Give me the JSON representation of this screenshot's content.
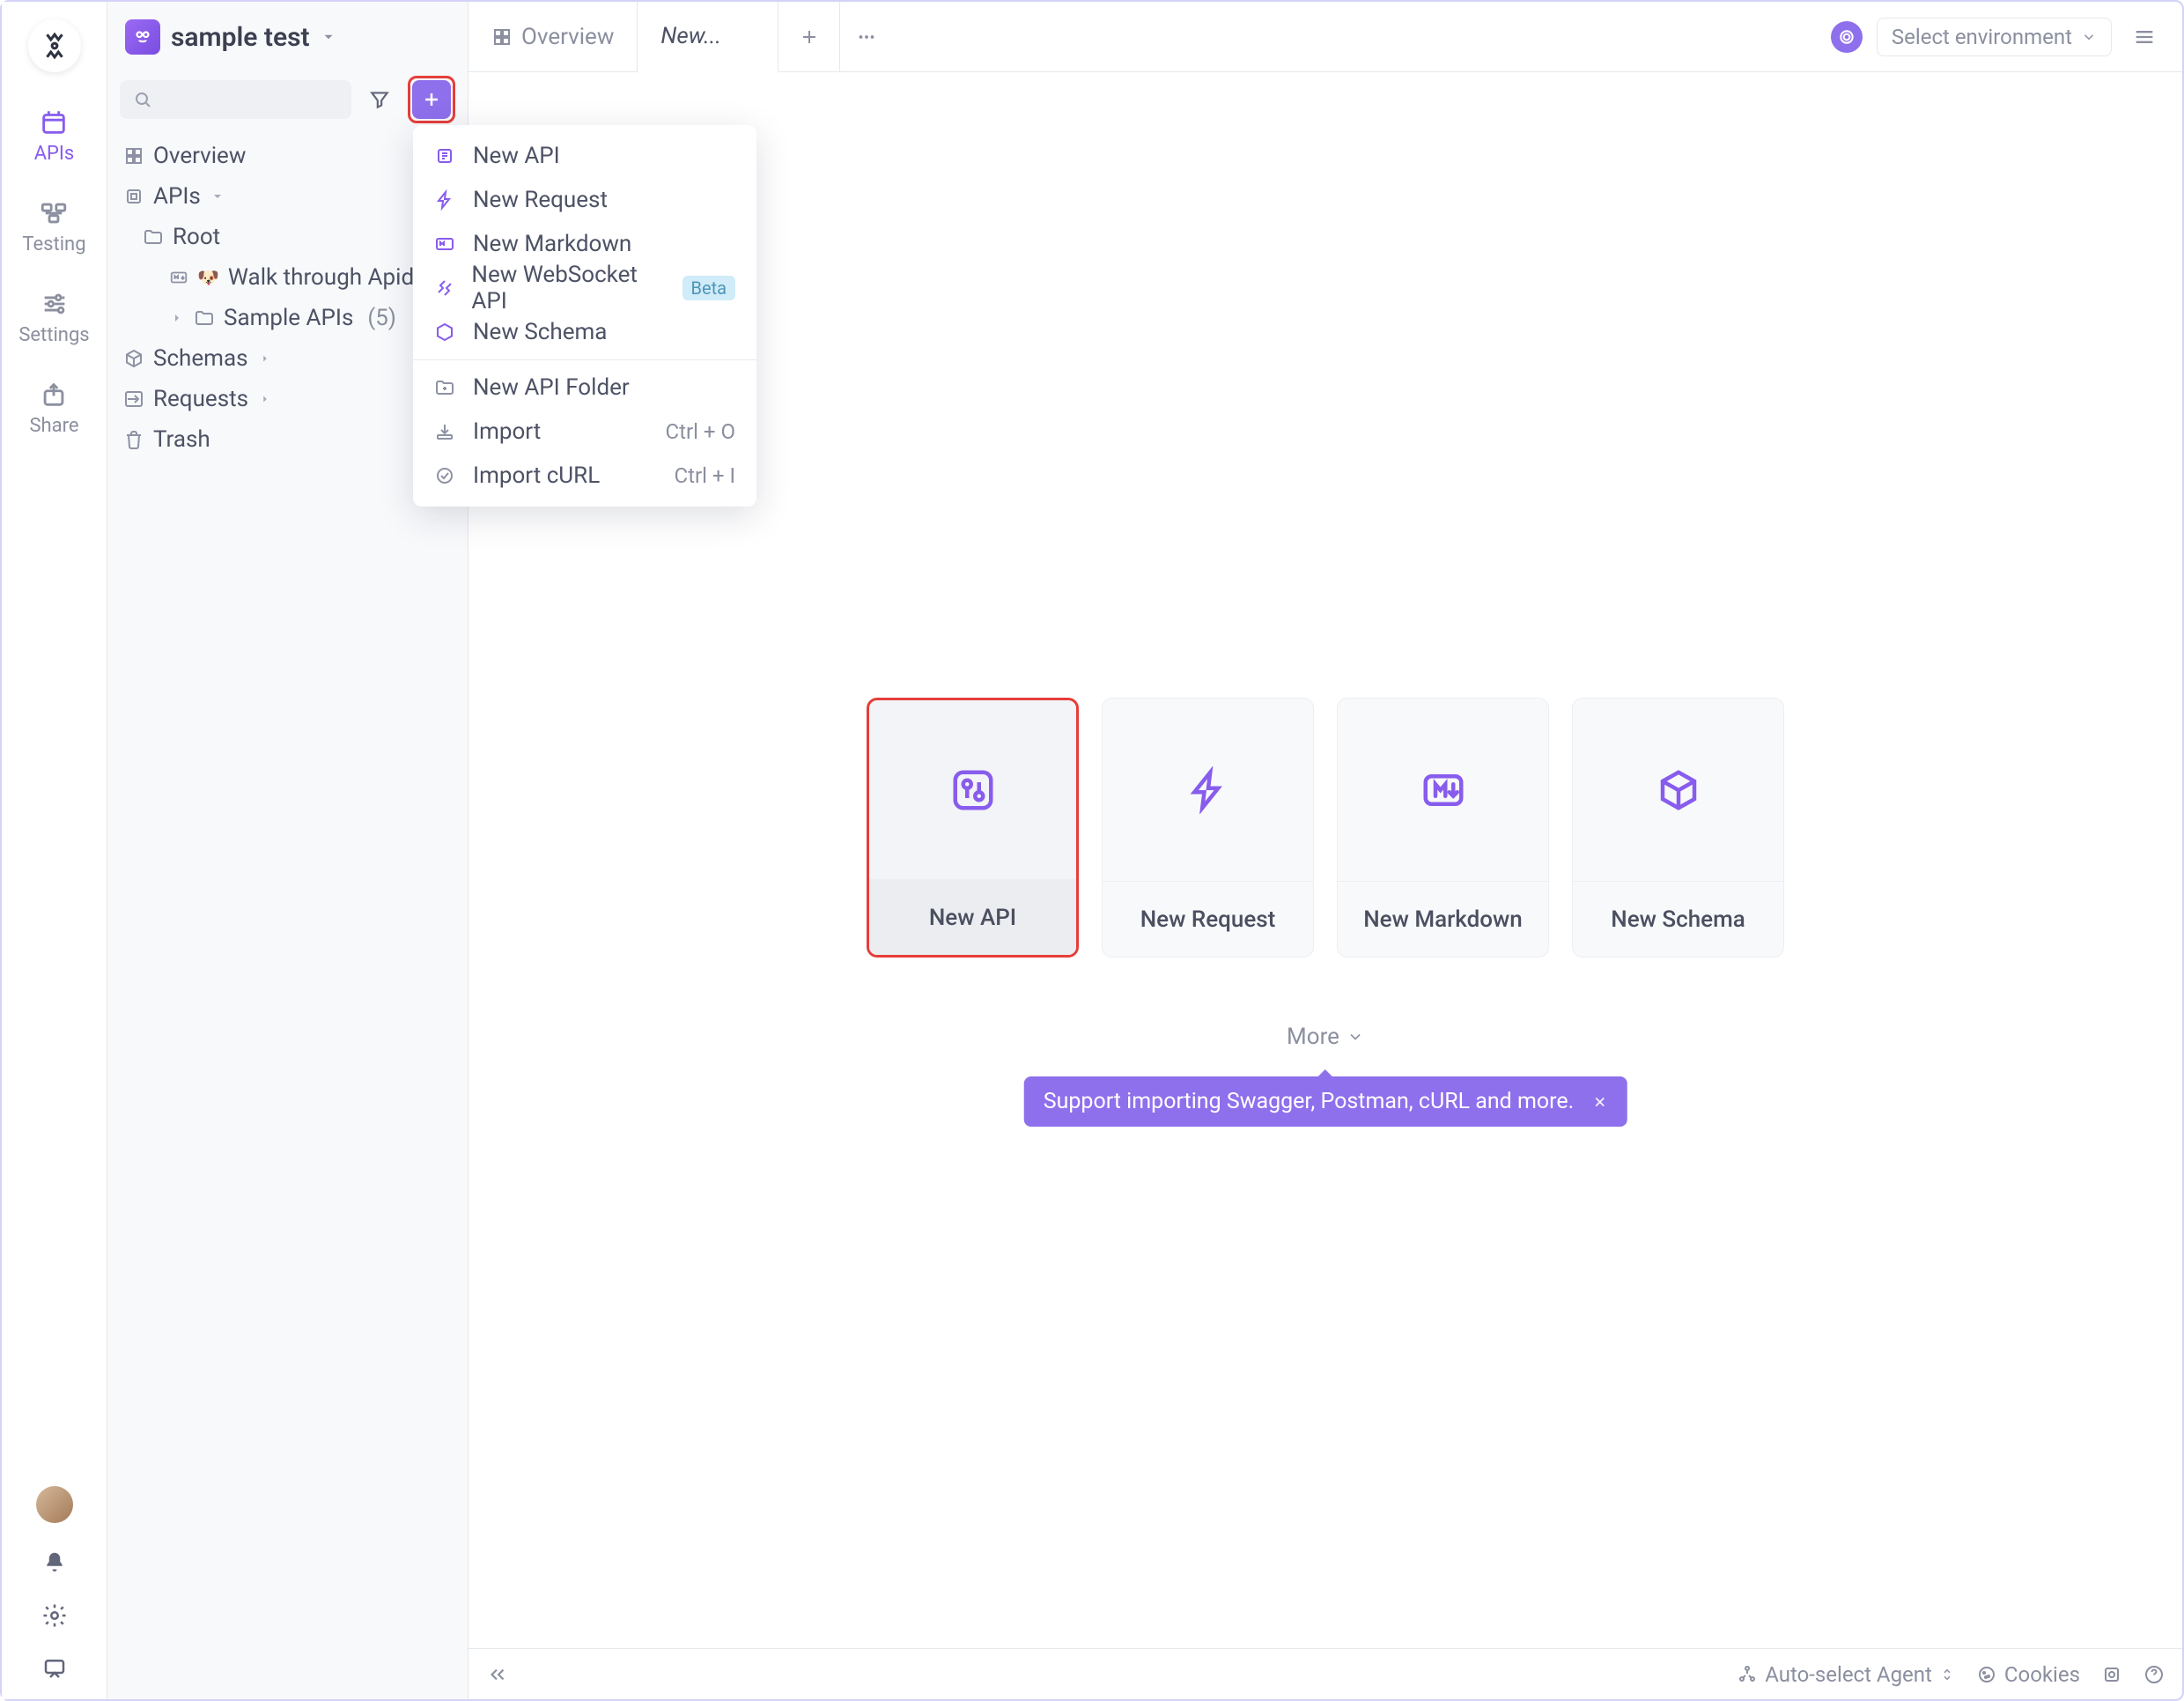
{
  "rail": {
    "items": [
      {
        "label": "APIs"
      },
      {
        "label": "Testing"
      },
      {
        "label": "Settings"
      },
      {
        "label": "Share"
      }
    ]
  },
  "project": {
    "name": "sample test"
  },
  "sidebar": {
    "overview": "Overview",
    "apis": "APIs",
    "root": "Root",
    "walk": "Walk through Apidog",
    "sample": "Sample APIs",
    "sample_count": "(5)",
    "schemas": "Schemas",
    "requests": "Requests",
    "trash": "Trash"
  },
  "tabs": [
    {
      "label": "Overview"
    },
    {
      "label": "New..."
    }
  ],
  "env": {
    "placeholder": "Select environment"
  },
  "menu": {
    "items": [
      {
        "label": "New API"
      },
      {
        "label": "New Request"
      },
      {
        "label": "New Markdown"
      },
      {
        "label": "New WebSocket API",
        "badge": "Beta"
      },
      {
        "label": "New Schema"
      }
    ],
    "section2": [
      {
        "label": "New API Folder"
      },
      {
        "label": "Import",
        "shortcut": "Ctrl + O"
      },
      {
        "label": "Import cURL",
        "shortcut": "Ctrl + I"
      }
    ]
  },
  "cards": [
    {
      "label": "New API"
    },
    {
      "label": "New Request"
    },
    {
      "label": "New Markdown"
    },
    {
      "label": "New Schema"
    }
  ],
  "more": "More",
  "toast": "Support importing Swagger, Postman, cURL and more.",
  "footer": {
    "agent": "Auto-select Agent",
    "cookies": "Cookies"
  }
}
